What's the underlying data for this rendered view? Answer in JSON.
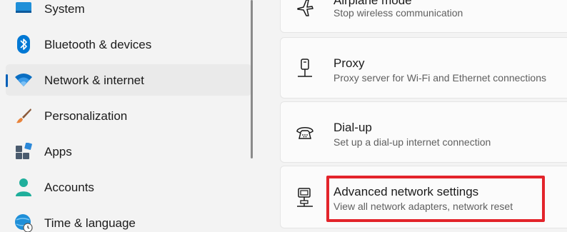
{
  "sidebar": {
    "items": [
      {
        "label": "System",
        "icon": "monitor-icon"
      },
      {
        "label": "Bluetooth & devices",
        "icon": "bluetooth-icon"
      },
      {
        "label": "Network & internet",
        "icon": "wifi-icon",
        "selected": true
      },
      {
        "label": "Personalization",
        "icon": "paintbrush-icon"
      },
      {
        "label": "Apps",
        "icon": "apps-icon"
      },
      {
        "label": "Accounts",
        "icon": "person-icon"
      },
      {
        "label": "Time & language",
        "icon": "globe-clock-icon"
      }
    ]
  },
  "main": {
    "cards": [
      {
        "title": "Airplane mode",
        "description": "Stop wireless communication",
        "icon": "airplane-icon"
      },
      {
        "title": "Proxy",
        "description": "Proxy server for Wi-Fi and Ethernet connections",
        "icon": "proxy-icon"
      },
      {
        "title": "Dial-up",
        "description": "Set up a dial-up internet connection",
        "icon": "phone-icon"
      },
      {
        "title": "Advanced network settings",
        "description": "View all network adapters, network reset",
        "icon": "network-computer-icon"
      }
    ]
  },
  "colors": {
    "accent": "#005fb8",
    "highlight": "#e3242b"
  }
}
